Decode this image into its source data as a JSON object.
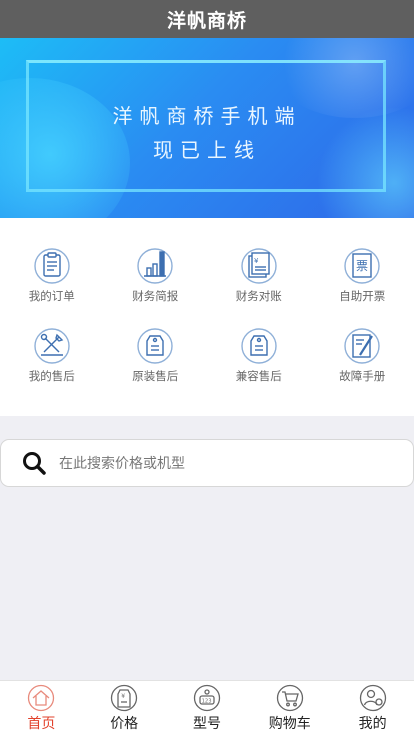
{
  "header": {
    "title": "洋帆商桥"
  },
  "banner": {
    "line1": "洋帆商桥手机端",
    "line2": "现已上线"
  },
  "grid": [
    {
      "label": "我的订单",
      "icon": "clipboard-order-icon"
    },
    {
      "label": "财务简报",
      "icon": "bar-chart-icon"
    },
    {
      "label": "财务对账",
      "icon": "yuan-document-icon"
    },
    {
      "label": "自助开票",
      "icon": "invoice-icon"
    },
    {
      "label": "我的售后",
      "icon": "wrench-hammer-icon"
    },
    {
      "label": "原装售后",
      "icon": "tag-icon"
    },
    {
      "label": "兼容售后",
      "icon": "tag-icon"
    },
    {
      "label": "故障手册",
      "icon": "manual-screwdriver-icon"
    }
  ],
  "search": {
    "placeholder": "在此搜索价格或机型"
  },
  "tabbar": [
    {
      "label": "首页",
      "icon": "home-icon",
      "active": true
    },
    {
      "label": "价格",
      "icon": "price-tag-icon",
      "active": false
    },
    {
      "label": "型号",
      "icon": "model-tag-icon",
      "active": false
    },
    {
      "label": "购物车",
      "icon": "cart-icon",
      "active": false
    },
    {
      "label": "我的",
      "icon": "user-gear-icon",
      "active": false
    }
  ],
  "colors": {
    "header": "#5f5f5f",
    "accent": "#e2412b",
    "icon_blue": "#3d6fb0"
  }
}
